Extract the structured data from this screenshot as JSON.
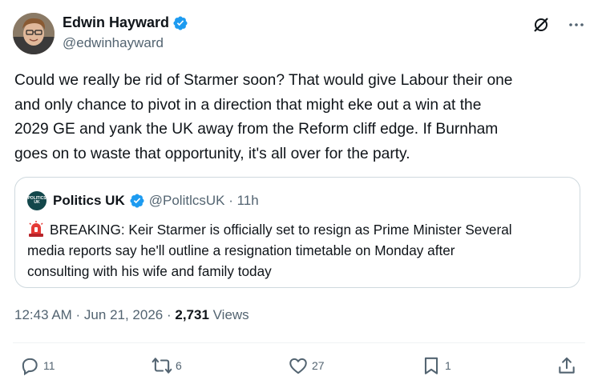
{
  "author": {
    "display_name": "Edwin Hayward",
    "handle": "@edwinhayward"
  },
  "tweet": {
    "lines": [
      "Could we really be rid of Starmer soon? That would give Labour their one",
      "and only chance to pivot in a direction that might eke out a win at the",
      "2029 GE and yank the UK away from the Reform cliff edge. If Burnham",
      "goes on to waste that opportunity, it's all over for the party."
    ]
  },
  "quote": {
    "display_name": "Politics UK",
    "handle_time": "@PolitlcsUK · 11h",
    "avatar_text": "POLITICS UK",
    "lines": [
      "BREAKING: Keir Starmer is officially set to resign as Prime Minister  Several",
      "media reports say he'll outline a resignation timetable on Monday after",
      "consulting with his wife and family today"
    ]
  },
  "meta": {
    "timestamp": "12:43 AM · Jun 21, 2026 · ",
    "views_count": "2,731",
    "views_label": " Views"
  },
  "actions": {
    "replies": "11",
    "reposts": "6",
    "likes": "27",
    "bookmarks": "1"
  },
  "colors": {
    "verified": "#1d9bf0",
    "text": "#0f1419",
    "secondary": "#536471",
    "border": "#cfd9de"
  }
}
